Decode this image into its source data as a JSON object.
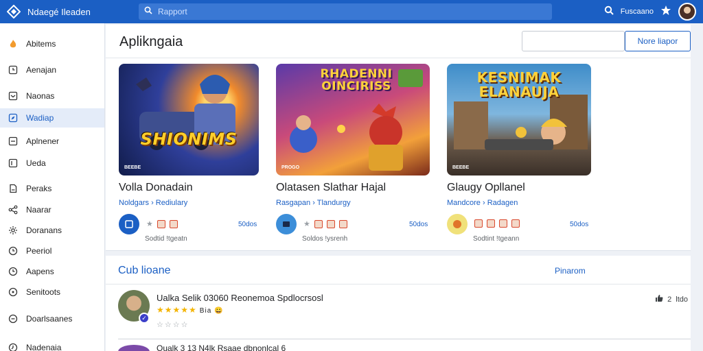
{
  "topbar": {
    "brand": "Ndaegé Ileaden",
    "search_placeholder": "Rapport",
    "user_link": "Fuscaano"
  },
  "sidebar": {
    "items": [
      {
        "label": "Abitems",
        "icon": "flame-icon"
      },
      {
        "label": "Aenajan",
        "icon": "clock-icon"
      },
      {
        "label": "Naonas",
        "icon": "inbox-icon"
      },
      {
        "label": "Wadiap",
        "icon": "compass-icon",
        "active": true
      },
      {
        "label": "Aplnener",
        "icon": "tray-icon"
      },
      {
        "label": "Ueda",
        "icon": "bookmark-icon"
      },
      {
        "label": "Peraks",
        "icon": "document-icon"
      },
      {
        "label": "Naarar",
        "icon": "share-icon"
      },
      {
        "label": "Doranans",
        "icon": "settings-icon"
      },
      {
        "label": "Peeriol",
        "icon": "clock-icon"
      },
      {
        "label": "Aapens",
        "icon": "clock-icon"
      },
      {
        "label": "Senitoots",
        "icon": "help-icon"
      },
      {
        "label": "Doarlsaanes",
        "icon": "chat-icon"
      },
      {
        "label": "Nadenaia",
        "icon": "history-icon"
      }
    ]
  },
  "main": {
    "title": "Aplikngaia",
    "more_button": "Nore liapor",
    "games": [
      {
        "banner": "SHIONIMS",
        "tag": "BEEBE",
        "name": "Volla Donadain",
        "meta": "Noldgars › Rediulary",
        "count": "50dos",
        "sub": "Sodtid !tgeatn"
      },
      {
        "banner": "RHADENNI OINCIRISS",
        "tag": "PROGO",
        "name": "Olatasen Slathar Hajal",
        "meta": "Rasgapan › Tlandurgy",
        "count": "50dos",
        "sub": "Soldos !ysrenh"
      },
      {
        "banner": "KESNIMAK ELANAUJA",
        "tag": "BEEBE",
        "name": "Glaugy Opllanel",
        "meta": "Mandcore › Radagen",
        "count": "50dos",
        "sub": "Sodtint !tgeann"
      }
    ]
  },
  "club": {
    "title": "Cub lioane",
    "link": "Pinarom",
    "review": {
      "title": "Ualka Selik 03060 Reonemoa Spdlocrsosl",
      "stars": "★★★★★",
      "extra": "Bia 😀",
      "stars2": "☆☆☆☆",
      "likes": "2",
      "likes_label": "ltdo"
    },
    "next_text": "Oualk 3 13 N4lk Rsaae dbnonlcal 6"
  },
  "colors": {
    "accent": "#1b5fc4",
    "topbar": "#1b5fc4",
    "sidebar_active": "#e4ecf9",
    "star": "#f4b400"
  }
}
